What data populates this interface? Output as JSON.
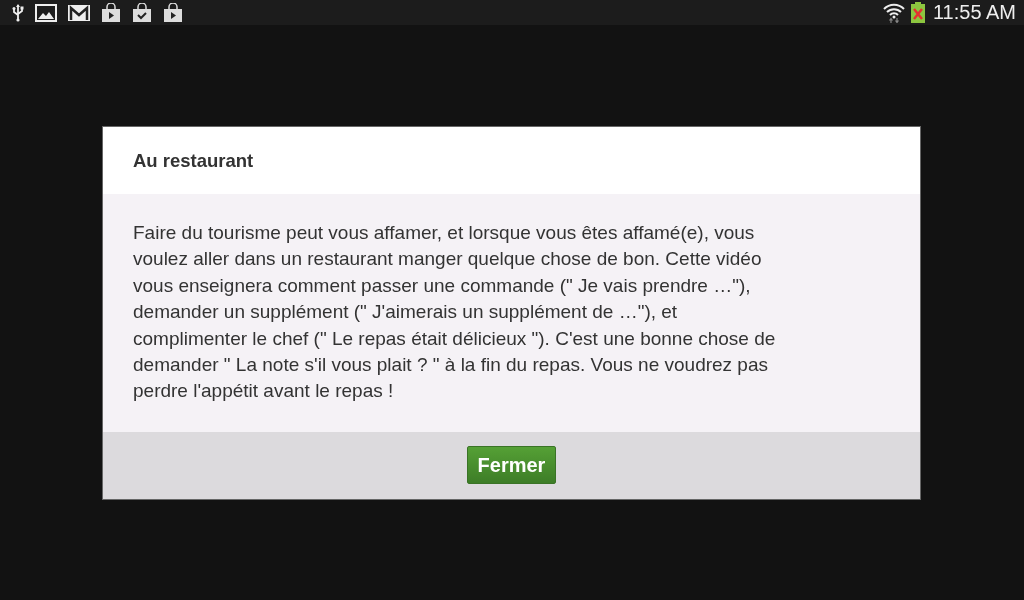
{
  "status_bar": {
    "notifications": [
      {
        "kind": "usb"
      },
      {
        "kind": "picture"
      },
      {
        "kind": "mail"
      },
      {
        "kind": "bag-play"
      },
      {
        "kind": "bag-check"
      },
      {
        "kind": "bag-play"
      }
    ],
    "time": "11:55 AM"
  },
  "dialog": {
    "title": "Au restaurant",
    "lines": [
      "Faire du tourisme peut vous affamer, et lorsque vous êtes affamé(e), vous",
      "voulez aller dans un restaurant manger quelque chose de bon. Cette vidéo",
      "vous enseignera comment passer une commande (\" Je vais prendre …\"),",
      "demander un supplément (\" J'aimerais un supplément de …\"), et",
      "complimenter le chef (\" Le repas était délicieux \"). C'est une bonne chose de",
      "demander \" La note s'il vous plait ? \" à la fin du repas. Vous ne voudrez pas",
      "perdre l'appétit avant le repas !"
    ],
    "buttons": [
      "Fermer"
    ]
  }
}
